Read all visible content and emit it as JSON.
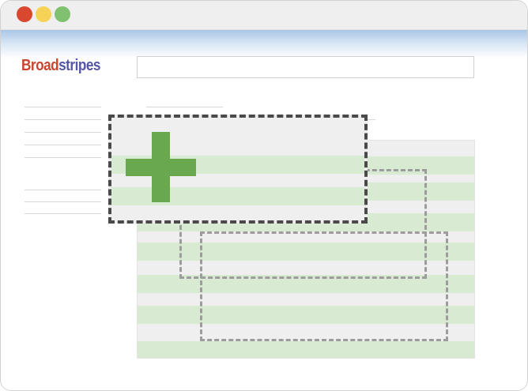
{
  "window": {
    "controls": {
      "close_color": "#d9472f",
      "minimize_color": "#f6d257",
      "maximize_color": "#7fc16f"
    }
  },
  "header": {
    "logo": {
      "part1": "Broad",
      "part2": "stripes",
      "part1_color": "#c9452f",
      "part2_color": "#5656a8"
    },
    "search": {
      "value": "",
      "placeholder": ""
    }
  },
  "content": {
    "row_colors": {
      "light_gray": "#efefef",
      "light_green": "#d9ead3"
    },
    "drop_zone_icon": "plus-icon",
    "plus_color": "#6aa84f",
    "drop_border_color": "#4a4a4a",
    "ghost_border_color": "#9c9c9c"
  }
}
